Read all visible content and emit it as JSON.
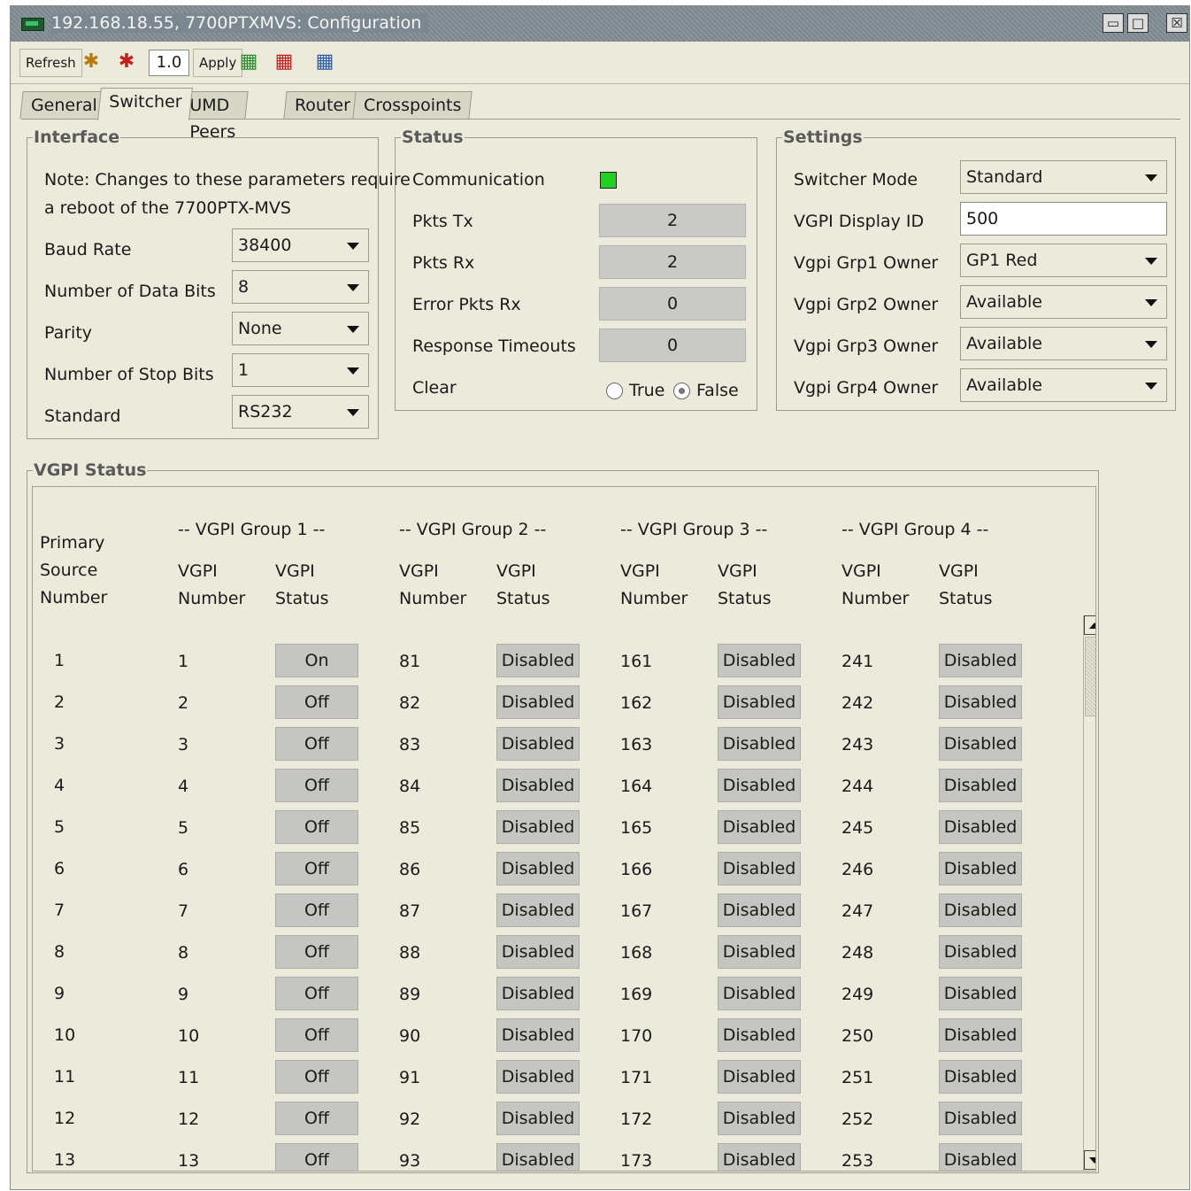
{
  "window": {
    "title": "192.168.18.55, 7700PTXMVS: Configuration"
  },
  "toolbar": {
    "refresh_label": "Refresh",
    "zoom_value": "1.0",
    "apply_label": "Apply"
  },
  "tabs": [
    "General",
    "Switcher",
    "UMD Peers",
    "Router",
    "Crosspoints"
  ],
  "interface": {
    "legend": "Interface",
    "note_line1": "Note: Changes to these parameters require",
    "note_line2": "a reboot of the 7700PTX-MVS",
    "baud_label": "Baud Rate",
    "baud_value": "38400",
    "databits_label": "Number of Data Bits",
    "databits_value": "8",
    "parity_label": "Parity",
    "parity_value": "None",
    "stopbits_label": "Number of Stop Bits",
    "stopbits_value": "1",
    "standard_label": "Standard",
    "standard_value": "RS232"
  },
  "status": {
    "legend": "Status",
    "communication_label": "Communication",
    "communication_color": "#1fd21f",
    "pkts_tx_label": "Pkts Tx",
    "pkts_tx": "2",
    "pkts_rx_label": "Pkts Rx",
    "pkts_rx": "2",
    "error_label": "Error Pkts Rx",
    "error_rx": "0",
    "timeouts_label": "Response Timeouts",
    "timeouts": "0",
    "clear_label": "Clear",
    "true_label": "True",
    "false_label": "False",
    "clear_selected": "False"
  },
  "settings": {
    "legend": "Settings",
    "mode_label": "Switcher Mode",
    "mode_value": "Standard",
    "display_label": "VGPI Display ID",
    "display_value": "500",
    "grp1_label": "Vgpi Grp1 Owner",
    "grp1_value": "GP1 Red",
    "grp2_label": "Vgpi Grp2 Owner",
    "grp2_value": "Available",
    "grp3_label": "Vgpi Grp3 Owner",
    "grp3_value": "Available",
    "grp4_label": "Vgpi Grp4 Owner",
    "grp4_value": "Available"
  },
  "vgpi": {
    "legend": "VGPI Status",
    "primary_header": [
      "Primary",
      "Source",
      "Number"
    ],
    "group_titles": [
      "-- VGPI Group 1 --",
      "-- VGPI Group 2 --",
      "-- VGPI Group 3 --",
      "-- VGPI Group 4 --"
    ],
    "number_header": [
      "VGPI",
      "Number"
    ],
    "status_header": [
      "VGPI",
      "Status"
    ],
    "rows": [
      {
        "src": "1",
        "g": [
          [
            "1",
            "On"
          ],
          [
            "81",
            "Disabled"
          ],
          [
            "161",
            "Disabled"
          ],
          [
            "241",
            "Disabled"
          ]
        ]
      },
      {
        "src": "2",
        "g": [
          [
            "2",
            "Off"
          ],
          [
            "82",
            "Disabled"
          ],
          [
            "162",
            "Disabled"
          ],
          [
            "242",
            "Disabled"
          ]
        ]
      },
      {
        "src": "3",
        "g": [
          [
            "3",
            "Off"
          ],
          [
            "83",
            "Disabled"
          ],
          [
            "163",
            "Disabled"
          ],
          [
            "243",
            "Disabled"
          ]
        ]
      },
      {
        "src": "4",
        "g": [
          [
            "4",
            "Off"
          ],
          [
            "84",
            "Disabled"
          ],
          [
            "164",
            "Disabled"
          ],
          [
            "244",
            "Disabled"
          ]
        ]
      },
      {
        "src": "5",
        "g": [
          [
            "5",
            "Off"
          ],
          [
            "85",
            "Disabled"
          ],
          [
            "165",
            "Disabled"
          ],
          [
            "245",
            "Disabled"
          ]
        ]
      },
      {
        "src": "6",
        "g": [
          [
            "6",
            "Off"
          ],
          [
            "86",
            "Disabled"
          ],
          [
            "166",
            "Disabled"
          ],
          [
            "246",
            "Disabled"
          ]
        ]
      },
      {
        "src": "7",
        "g": [
          [
            "7",
            "Off"
          ],
          [
            "87",
            "Disabled"
          ],
          [
            "167",
            "Disabled"
          ],
          [
            "247",
            "Disabled"
          ]
        ]
      },
      {
        "src": "8",
        "g": [
          [
            "8",
            "Off"
          ],
          [
            "88",
            "Disabled"
          ],
          [
            "168",
            "Disabled"
          ],
          [
            "248",
            "Disabled"
          ]
        ]
      },
      {
        "src": "9",
        "g": [
          [
            "9",
            "Off"
          ],
          [
            "89",
            "Disabled"
          ],
          [
            "169",
            "Disabled"
          ],
          [
            "249",
            "Disabled"
          ]
        ]
      },
      {
        "src": "10",
        "g": [
          [
            "10",
            "Off"
          ],
          [
            "90",
            "Disabled"
          ],
          [
            "170",
            "Disabled"
          ],
          [
            "250",
            "Disabled"
          ]
        ]
      },
      {
        "src": "11",
        "g": [
          [
            "11",
            "Off"
          ],
          [
            "91",
            "Disabled"
          ],
          [
            "171",
            "Disabled"
          ],
          [
            "251",
            "Disabled"
          ]
        ]
      },
      {
        "src": "12",
        "g": [
          [
            "12",
            "Off"
          ],
          [
            "92",
            "Disabled"
          ],
          [
            "172",
            "Disabled"
          ],
          [
            "252",
            "Disabled"
          ]
        ]
      },
      {
        "src": "13",
        "g": [
          [
            "13",
            "Off"
          ],
          [
            "93",
            "Disabled"
          ],
          [
            "173",
            "Disabled"
          ],
          [
            "253",
            "Disabled"
          ]
        ]
      }
    ]
  }
}
